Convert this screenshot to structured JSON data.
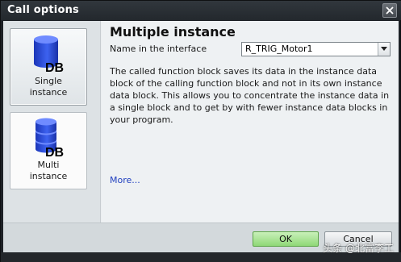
{
  "window": {
    "title": "Call options",
    "close_icon": "close-icon"
  },
  "choices": [
    {
      "label_line1": "Single",
      "label_line2": "instance",
      "icon": "db-icon",
      "selected": true
    },
    {
      "label_line1": "Multi",
      "label_line2": "instance",
      "icon": "multi-db-icon",
      "selected": false
    }
  ],
  "db_badge": "DB",
  "main": {
    "heading": "Multiple instance",
    "name_label": "Name in the interface",
    "name_value": "R_TRIG_Motor1",
    "description": "The called function block saves its data in the instance data block of the calling function block and not in its own instance data block. This allows you to concentrate the instance data in a single block and to get by with fewer instance data blocks in your program.",
    "more_link": "More..."
  },
  "buttons": {
    "ok": "OK",
    "cancel": "Cancel"
  },
  "watermark": "头条 @北富李工",
  "colors": {
    "ok_green": "#8fd877",
    "db_blue": "#2f4fd8",
    "link_blue": "#1f3fbf"
  }
}
